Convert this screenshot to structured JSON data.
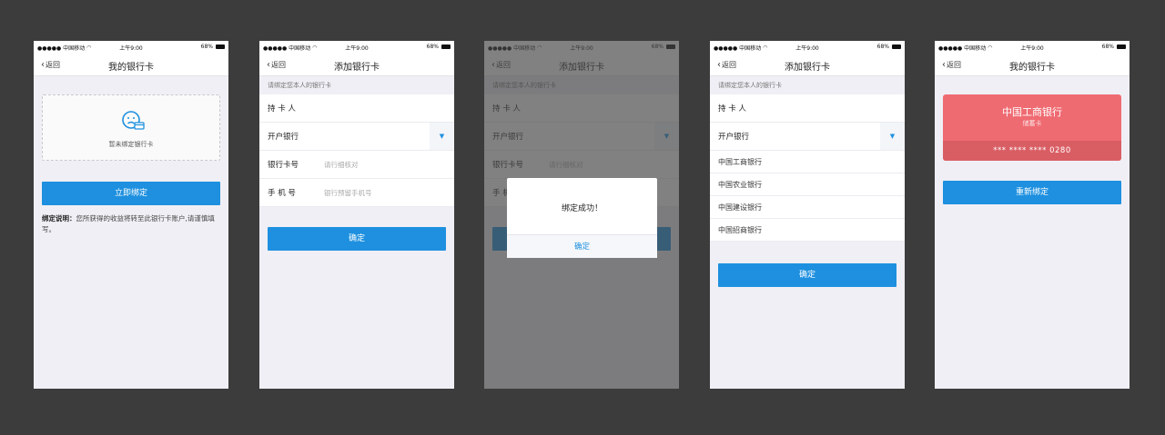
{
  "status": {
    "carrier": "●●●●● 中国移动",
    "time": "上午9:00",
    "battery": "68%"
  },
  "nav": {
    "back": "返回",
    "title_my_cards": "我的银行卡",
    "title_add_card": "添加银行卡"
  },
  "screen1": {
    "empty_text": "暂未绑定银行卡",
    "bind_button": "立即绑定",
    "note_label": "绑定说明：",
    "note_text": "您所获得的收益将转至此银行卡账户,请谨慎填写。"
  },
  "form": {
    "hint": "请绑定您本人的银行卡",
    "cardholder_label": "持 卡 人",
    "bank_label": "开户银行",
    "dropdown_arrow": "▼",
    "card_no_label": "银行卡号",
    "card_no_placeholder": "请行细核对",
    "phone_label": "手 机 号",
    "phone_placeholder": "银行预留手机号",
    "confirm_button": "确定"
  },
  "dialog": {
    "message": "绑定成功！",
    "button": "确定"
  },
  "bank_options": [
    "中国工商银行",
    "中国农业银行",
    "中国建设银行",
    "中国招商银行"
  ],
  "card": {
    "bank_name": "中国工商银行",
    "card_type": "储蓄卡",
    "masked_number": "***  ****  ****   0280",
    "rebind_button": "重新绑定"
  },
  "colors": {
    "accent": "#1e90df",
    "card_red": "#ef6b72",
    "background": "#3c3c3c"
  }
}
